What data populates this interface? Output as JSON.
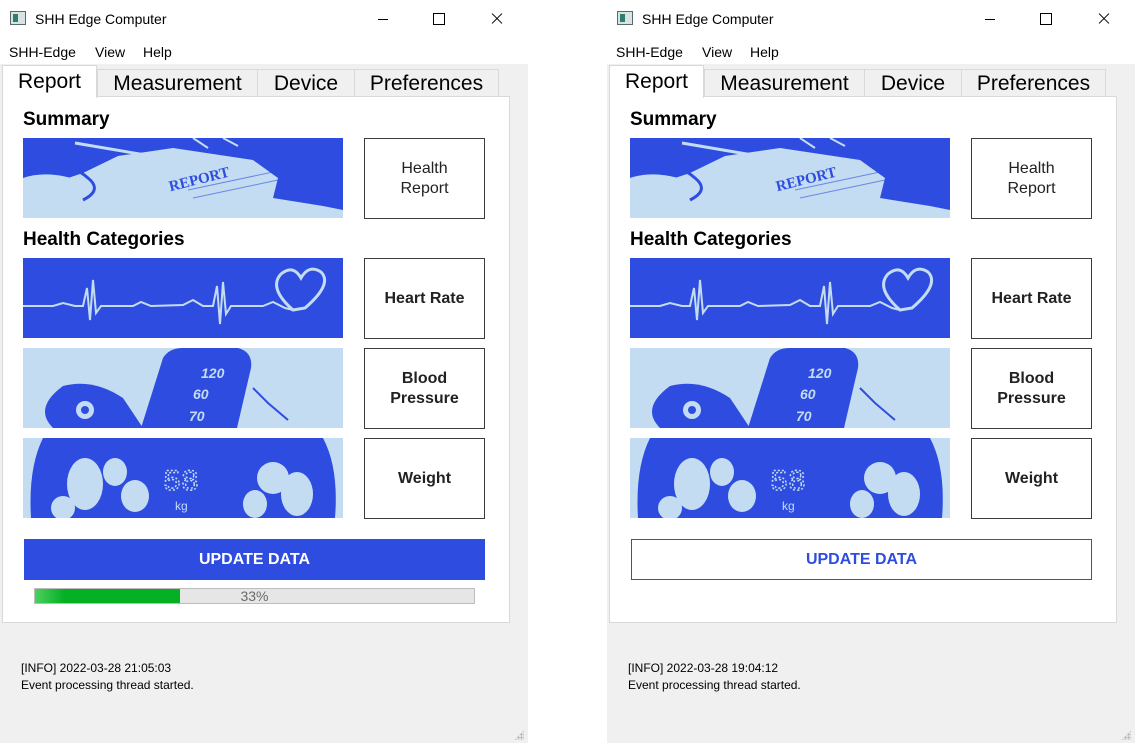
{
  "windows": [
    {
      "title": "SHH Edge Computer",
      "menu": [
        "SHH-Edge",
        "View",
        "Help"
      ],
      "tabs": [
        "Report",
        "Measurement",
        "Device",
        "Preferences"
      ],
      "active_tab": "Report",
      "summary_title": "Summary",
      "categories_title": "Health Categories",
      "image_labels": {
        "report": "REPORT",
        "bp_top": "120",
        "bp_mid": "60",
        "bp_low": "70",
        "weight_value": "58",
        "weight_unit": "kg"
      },
      "buttons": {
        "health_report": "Health\nReport",
        "heart_rate": "Heart Rate",
        "blood_pressure": "Blood\nPressure",
        "weight": "Weight"
      },
      "update_label": "UPDATE DATA",
      "update_style": "filled",
      "progress": {
        "value_percent": 33,
        "text": "33%"
      },
      "log": {
        "line1": "[INFO] 2022-03-28 21:05:03",
        "line2": "Event processing thread started."
      }
    },
    {
      "title": "SHH Edge Computer",
      "menu": [
        "SHH-Edge",
        "View",
        "Help"
      ],
      "tabs": [
        "Report",
        "Measurement",
        "Device",
        "Preferences"
      ],
      "active_tab": "Report",
      "summary_title": "Summary",
      "categories_title": "Health Categories",
      "image_labels": {
        "report": "REPORT",
        "bp_top": "120",
        "bp_mid": "60",
        "bp_low": "70",
        "weight_value": "58",
        "weight_unit": "kg"
      },
      "buttons": {
        "health_report": "Health\nReport",
        "heart_rate": "Heart Rate",
        "blood_pressure": "Blood\nPressure",
        "weight": "Weight"
      },
      "update_label": "UPDATE DATA",
      "update_style": "outline",
      "progress": null,
      "log": {
        "line1": "[INFO] 2022-03-28 19:04:12",
        "line2": "Event processing thread started."
      }
    }
  ],
  "colors": {
    "accent_blue": "#2e4de0",
    "image_light": "#c4dcf2",
    "progress_green": "#06b025"
  }
}
